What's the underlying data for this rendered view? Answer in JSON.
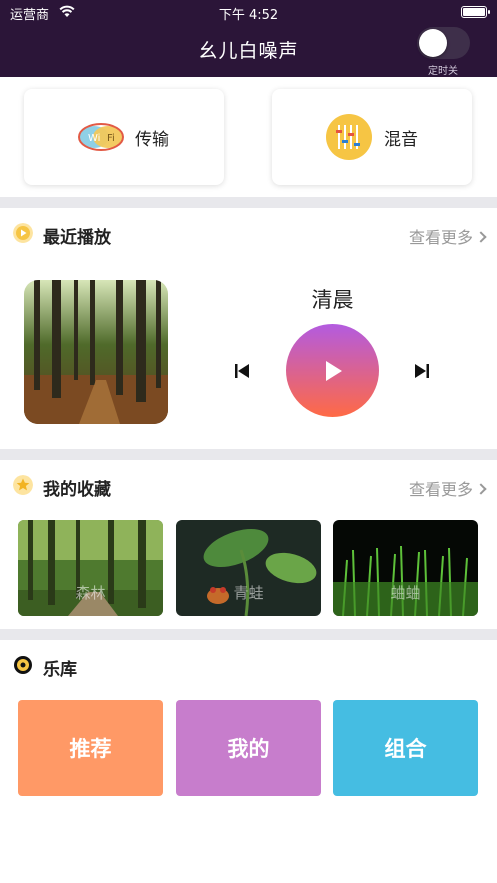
{
  "status_bar": {
    "carrier": "运营商",
    "time": "下午 4:52"
  },
  "header": {
    "title": "幺儿白噪声",
    "timer_label": "定时关",
    "timer_on": false
  },
  "quick_actions": [
    {
      "label": "传输",
      "icon": "wifi-icon"
    },
    {
      "label": "混音",
      "icon": "mixer-icon"
    }
  ],
  "recent": {
    "title": "最近播放",
    "more": "查看更多",
    "track": "清晨"
  },
  "favorites": {
    "title": "我的收藏",
    "more": "查看更多",
    "items": [
      "森林",
      "青蛙",
      "蛐蛐"
    ]
  },
  "library": {
    "title": "乐库",
    "items": [
      {
        "label": "推荐",
        "color": "#ff9966"
      },
      {
        "label": "我的",
        "color": "#c77dcc"
      },
      {
        "label": "组合",
        "color": "#45bde2"
      }
    ]
  }
}
